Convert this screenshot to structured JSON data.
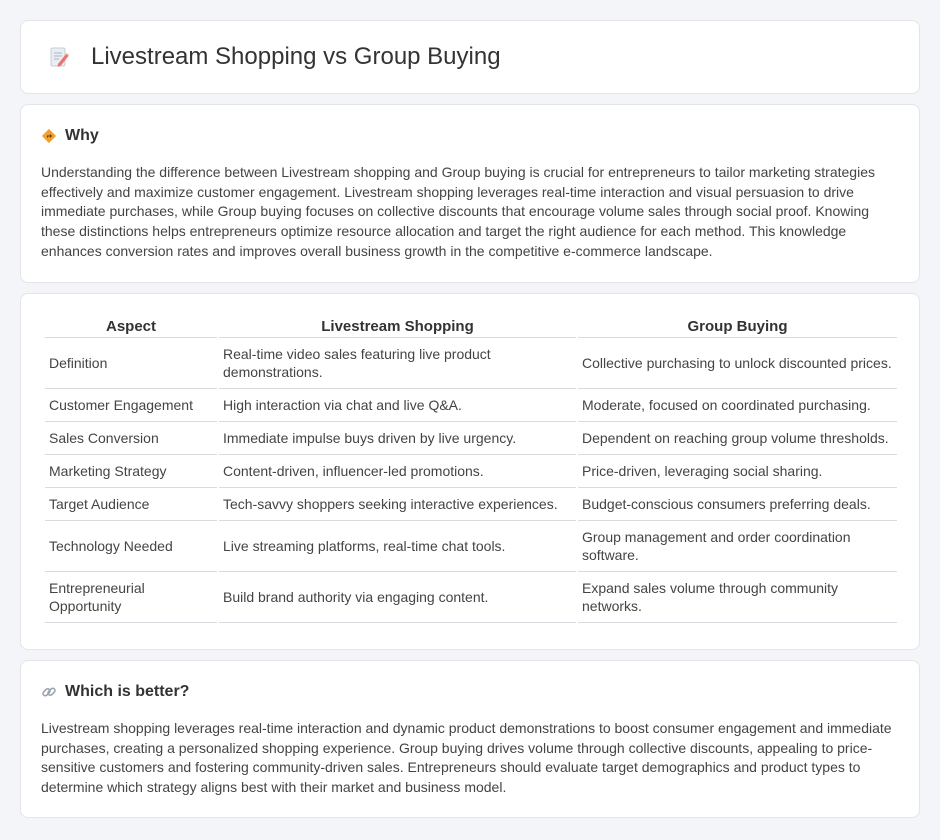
{
  "header": {
    "title": "Livestream Shopping vs Group Buying",
    "icon": "document-pencil-icon"
  },
  "why": {
    "title": "Why",
    "icon": "diamond-sign-icon",
    "text": "Understanding the difference between Livestream shopping and Group buying is crucial for entrepreneurs to tailor marketing strategies effectively and maximize customer engagement. Livestream shopping leverages real-time interaction and visual persuasion to drive immediate purchases, while Group buying focuses on collective discounts that encourage volume sales through social proof. Knowing these distinctions helps entrepreneurs optimize resource allocation and target the right audience for each method. This knowledge enhances conversion rates and improves overall business growth in the competitive e-commerce landscape."
  },
  "table": {
    "headers": [
      "Aspect",
      "Livestream Shopping",
      "Group Buying"
    ],
    "rows": [
      [
        "Definition",
        "Real-time video sales featuring live product demonstrations.",
        "Collective purchasing to unlock discounted prices."
      ],
      [
        "Customer Engagement",
        "High interaction via chat and live Q&A.",
        "Moderate, focused on coordinated purchasing."
      ],
      [
        "Sales Conversion",
        "Immediate impulse buys driven by live urgency.",
        "Dependent on reaching group volume thresholds."
      ],
      [
        "Marketing Strategy",
        "Content-driven, influencer-led promotions.",
        "Price-driven, leveraging social sharing."
      ],
      [
        "Target Audience",
        "Tech-savvy shoppers seeking interactive experiences.",
        "Budget-conscious consumers preferring deals."
      ],
      [
        "Technology Needed",
        "Live streaming platforms, real-time chat tools.",
        "Group management and order coordination software."
      ],
      [
        "Entrepreneurial Opportunity",
        "Build brand authority via engaging content.",
        "Expand sales volume through community networks."
      ]
    ]
  },
  "better": {
    "title": "Which is better?",
    "icon": "link-icon",
    "text": "Livestream shopping leverages real-time interaction and dynamic product demonstrations to boost consumer engagement and immediate purchases, creating a personalized shopping experience. Group buying drives volume through collective discounts, appealing to price-sensitive customers and fostering community-driven sales. Entrepreneurs should evaluate target demographics and product types to determine which strategy aligns best with their market and business model."
  },
  "colors": {
    "background": "#f4f5f8",
    "card": "#ffffff",
    "border": "#e3e5ea",
    "accent_orange": "#f0a030",
    "accent_pink": "#e8766a"
  }
}
